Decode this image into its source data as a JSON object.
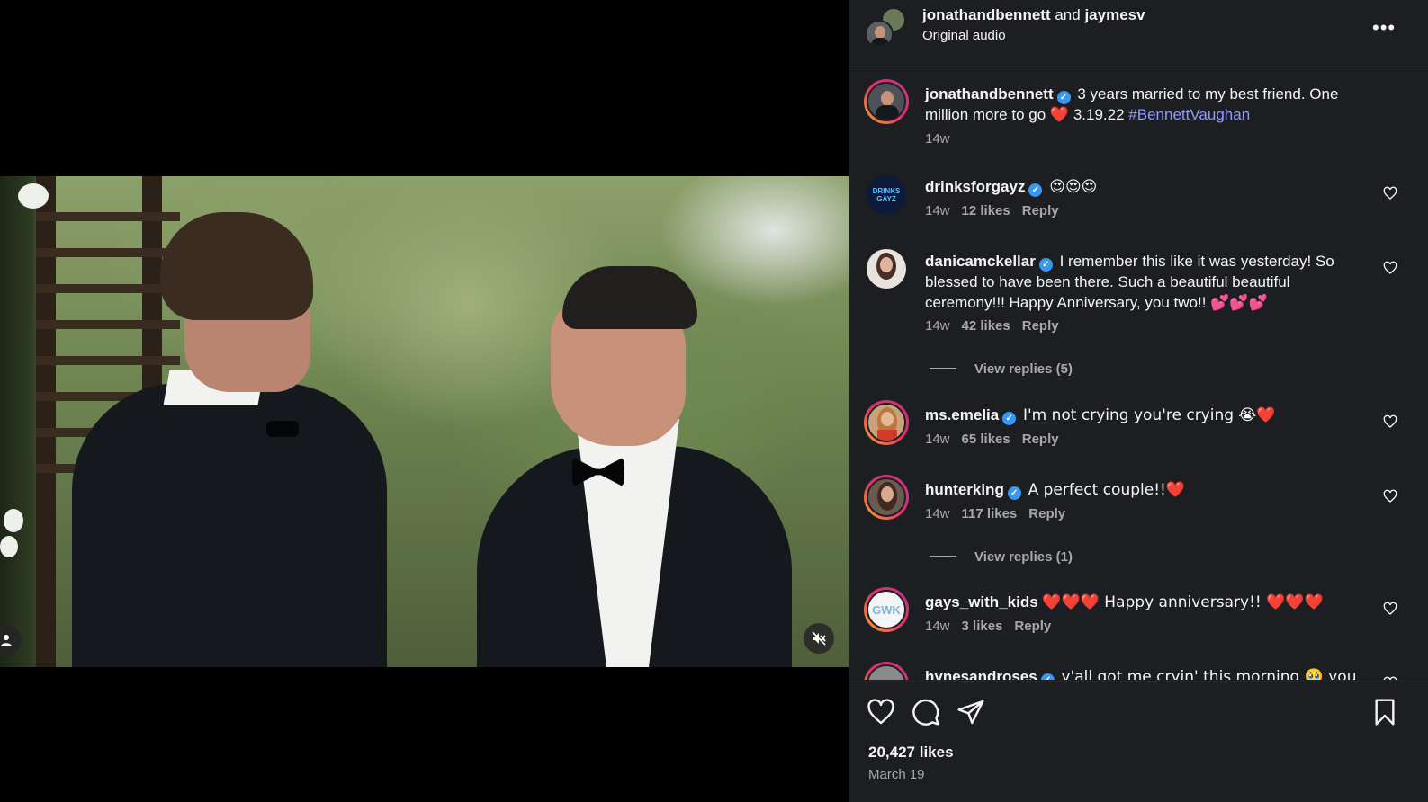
{
  "header": {
    "user1": "jonathandbennett",
    "joiner": "and",
    "user2": "jaymesv",
    "audio": "Original audio",
    "more_label": "•••"
  },
  "caption": {
    "user": "jonathandbennett",
    "text_1": "3 years married to my best friend. One million more to go",
    "heart": "❤️",
    "text_2": "3.19.22",
    "hashtag": "#BennettVaughan",
    "time": "14w"
  },
  "comments": [
    {
      "user": "drinksforgayz",
      "text": "😍😍😍",
      "time": "14w",
      "likes": "12 likes",
      "reply": "Reply"
    },
    {
      "user": "danicamckellar",
      "text": "I remember this like it was yesterday! So blessed to have been there. Such a beautiful beautiful ceremony!!! Happy Anniversary, you two!! 💕💕💕",
      "time": "14w",
      "likes": "42 likes",
      "reply": "Reply",
      "view_replies": "View replies (5)"
    },
    {
      "user": "ms.emelia",
      "text": "I'm not crying you're crying 😭❤️",
      "time": "14w",
      "likes": "65 likes",
      "reply": "Reply"
    },
    {
      "user": "hunterking",
      "text": "A perfect couple!!❤️",
      "time": "14w",
      "likes": "117 likes",
      "reply": "Reply",
      "view_replies": "View replies (1)"
    },
    {
      "user": "gays_with_kids",
      "text": "❤️❤️❤️ Happy anniversary!! ❤️❤️❤️",
      "time": "14w",
      "likes": "3 likes",
      "reply": "Reply"
    },
    {
      "user": "hynesandroses",
      "text": "y'all got me cryin' this morning 🥹 you"
    }
  ],
  "footer": {
    "likes": "20,427 likes",
    "date": "March 19"
  },
  "avatars": {
    "drinksforgayz_text": "DRINKS GAYZ",
    "gays_with_kids_text": "GWK"
  },
  "colors": {
    "panel_bg": "#1c1e22",
    "verified": "#3897f0",
    "hashtag": "#8f9aff",
    "muted_text": "#a8a8a8"
  },
  "icons": [
    "user-tag-icon",
    "mute-icon",
    "more-icon",
    "heart-icon",
    "comment-icon",
    "share-icon",
    "bookmark-icon"
  ]
}
